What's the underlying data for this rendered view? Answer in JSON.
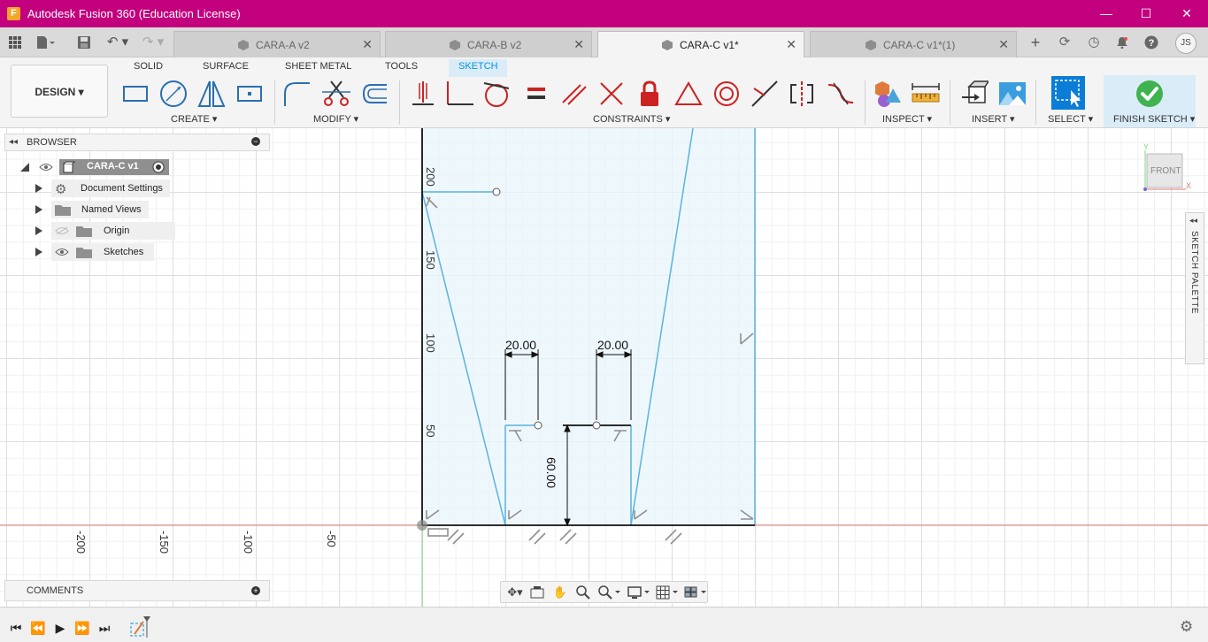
{
  "window": {
    "title": "Autodesk Fusion 360 (Education License)",
    "logo_letter": "F",
    "minimize": "—",
    "maximize": "☐",
    "close": "✕"
  },
  "tabs": [
    {
      "label": "CARA-A v2",
      "active": false
    },
    {
      "label": "CARA-B v2",
      "active": false
    },
    {
      "label": "CARA-C v1*",
      "active": true
    },
    {
      "label": "CARA-C v1*(1)",
      "active": false
    }
  ],
  "tab_close": "✕",
  "user_initials": "JS",
  "workspace": "DESIGN ▾",
  "workspace_tabs": [
    "SOLID",
    "SURFACE",
    "SHEET METAL",
    "TOOLS",
    "SKETCH"
  ],
  "active_workspace_tab": "SKETCH",
  "groups": {
    "create": "CREATE ▾",
    "modify": "MODIFY ▾",
    "constraints": "CONSTRAINTS ▾",
    "inspect": "INSPECT ▾",
    "insert": "INSERT ▾",
    "select": "SELECT ▾",
    "finish": "FINISH SKETCH ▾"
  },
  "browser": {
    "title": "BROWSER",
    "root": "CARA-C v1",
    "items": [
      "Document Settings",
      "Named Views",
      "Origin",
      "Sketches"
    ]
  },
  "comments_title": "COMMENTS",
  "sketch_palette": "SKETCH PALETTE",
  "viewcube_label": "FRONT",
  "viewcube_axes": {
    "y": "Y",
    "x": "X"
  },
  "axis_ticks": {
    "vertical": [
      "200",
      "150",
      "100",
      "50"
    ],
    "horizontal": [
      "-200",
      "-150",
      "-100",
      "-50"
    ]
  },
  "dimensions": {
    "left_width": "20.00",
    "right_width": "20.00",
    "height": "60.00"
  },
  "colors": {
    "title_bar": "#c3007d",
    "sketch_line": "#59b4de",
    "sketch_fill": "#e8f4fb",
    "accent": "#0696d7",
    "finish_check": "#3fb34f"
  }
}
